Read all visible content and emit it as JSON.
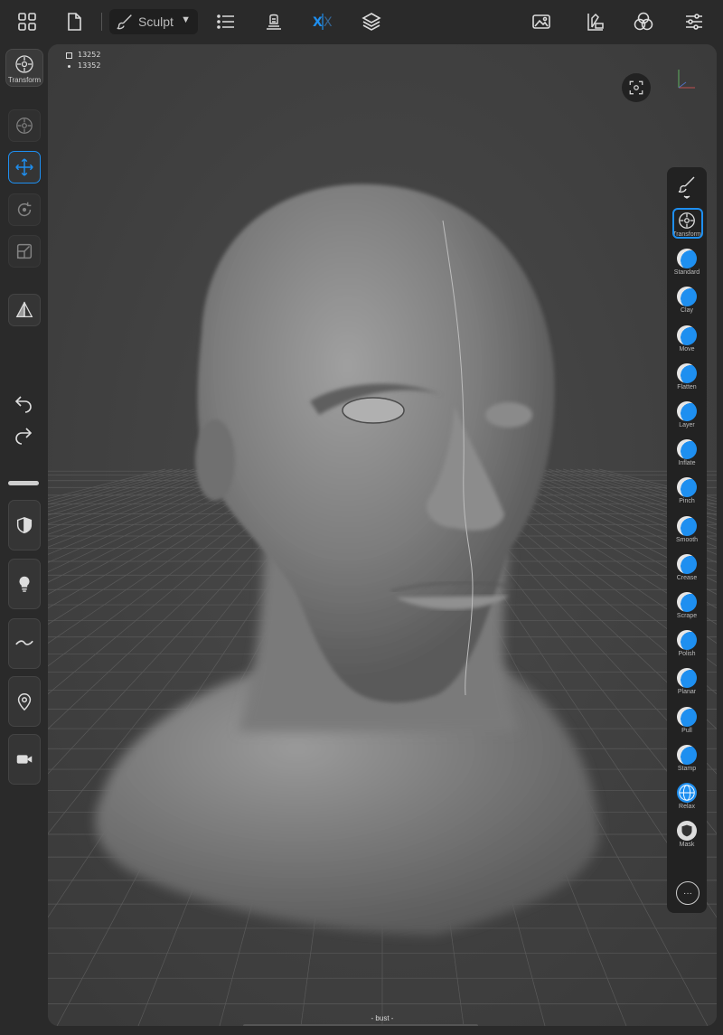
{
  "toolbar": {
    "tool_label": "Sculpt",
    "symmetry_label": "X|X",
    "icons": [
      "grid-icon",
      "file-icon",
      "list-icon",
      "scene-icon",
      "symmetry-icon",
      "layers-icon",
      "background-icon",
      "materials-icon",
      "lighting-icon",
      "settings-icon"
    ]
  },
  "left": {
    "transform_label": "Transform",
    "tools": [
      "gizmo-icon",
      "move-icon",
      "rotate-icon",
      "scale-icon",
      "symmetry-plane-icon",
      "undo-icon",
      "redo-icon",
      "shield-icon",
      "bulb-icon",
      "stroke-icon",
      "pin-icon",
      "camera-icon"
    ]
  },
  "viewport": {
    "stats_line1": "13252",
    "stats_line2": "13352",
    "mesh_name": "- bust -"
  },
  "palette": {
    "brushes": [
      {
        "label": "Transform"
      },
      {
        "label": "Standard"
      },
      {
        "label": "Clay"
      },
      {
        "label": "Move"
      },
      {
        "label": "Flatten"
      },
      {
        "label": "Layer"
      },
      {
        "label": "Inflate"
      },
      {
        "label": "Pinch"
      },
      {
        "label": "Smooth"
      },
      {
        "label": "Crease"
      },
      {
        "label": "Scrape"
      },
      {
        "label": "Polish"
      },
      {
        "label": "Planar"
      },
      {
        "label": "Pull"
      },
      {
        "label": "Stamp"
      },
      {
        "label": "Relax"
      },
      {
        "label": "Mask"
      }
    ],
    "more_label": "···"
  },
  "colors": {
    "accent": "#1e8ff0",
    "background": "#2a2a2a",
    "viewport": "#414141"
  }
}
